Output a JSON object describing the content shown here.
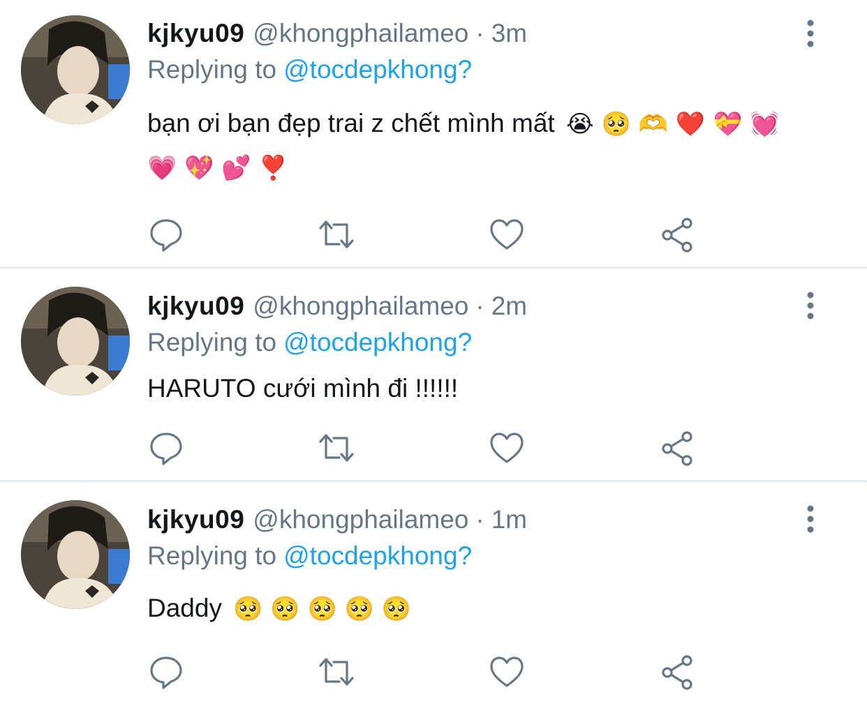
{
  "tweets": [
    {
      "username": "kjkyu09",
      "handle": "@khongphailameo",
      "separator": "·",
      "time": "3m",
      "replying_prefix": "Replying to",
      "replying_to": "@tocdepkhong?",
      "text_line1": "bạn ơi bạn đẹp trai z chết mình mất",
      "emoji_line1": "😭 🥺 🫶 ❤️ 💝 💓",
      "emoji_line2": "💗 💖 💕 ❣️"
    },
    {
      "username": "kjkyu09",
      "handle": "@khongphailameo",
      "separator": "·",
      "time": "2m",
      "replying_prefix": "Replying to",
      "replying_to": "@tocdepkhong?",
      "text_line1": "HARUTO cưới mình đi !!!!!!"
    },
    {
      "username": "kjkyu09",
      "handle": "@khongphailameo",
      "separator": "·",
      "time": "1m",
      "replying_prefix": "Replying to",
      "replying_to": "@tocdepkhong?",
      "text_line1": "Daddy",
      "emoji_line1": "🥺 🥺 🥺 🥺 🥺"
    }
  ],
  "icons": {
    "reply": "reply-icon",
    "retweet": "retweet-icon",
    "like": "like-icon",
    "share": "share-icon",
    "more": "more-vertical-icon"
  },
  "colors": {
    "icon_gray": "#657786",
    "link_blue": "#1da1f2",
    "divider": "#e6ecf0",
    "text": "#14171a"
  }
}
